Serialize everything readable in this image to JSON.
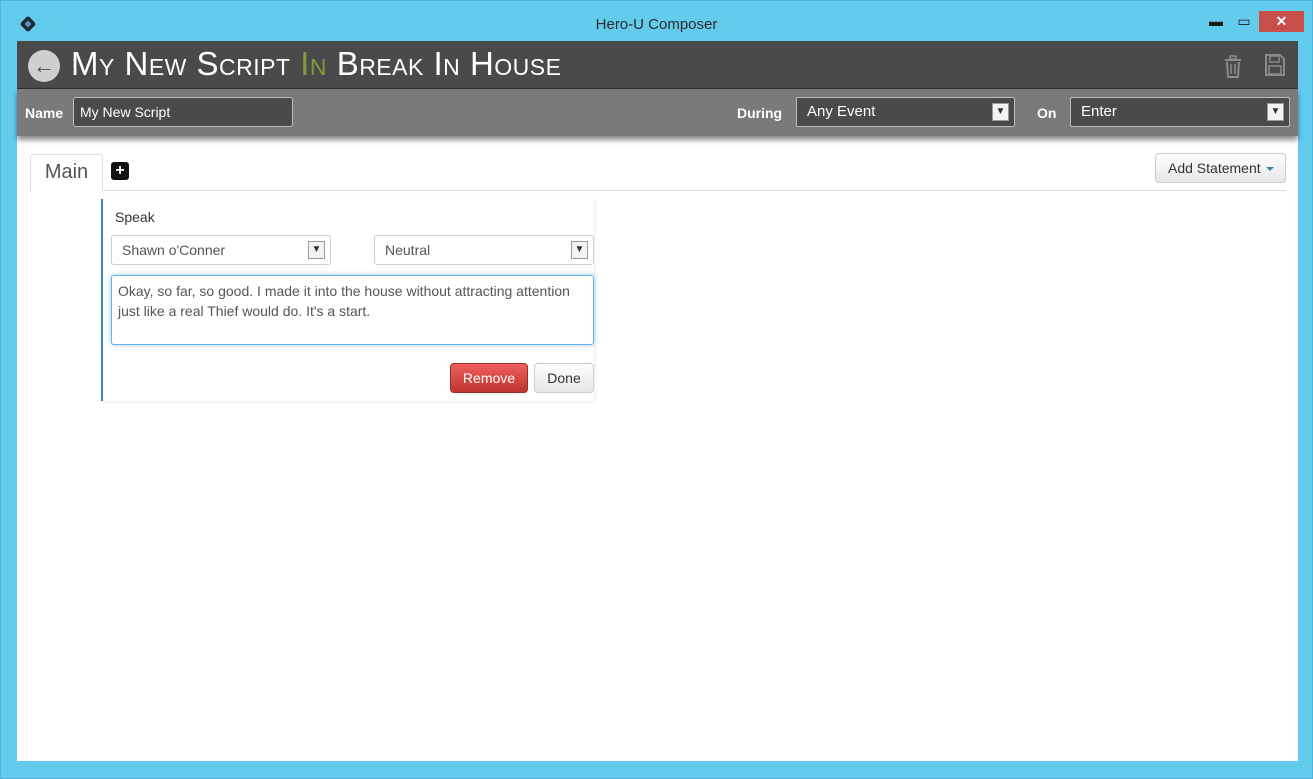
{
  "window": {
    "title": "Hero-U Composer",
    "minimize": "▬",
    "maximize": "▭",
    "close": "✕"
  },
  "header": {
    "title_parts": [
      "My New Script",
      "In",
      "Break In House"
    ],
    "back_icon": "arrow-left-icon",
    "trash_icon": "trash-icon",
    "save_icon": "save-icon",
    "accent_color": "#7f9b3c"
  },
  "subbar": {
    "name_label": "Name",
    "name_value": "My New Script",
    "during_label": "During",
    "during_value": "Any Event",
    "on_label": "On",
    "on_value": "Enter"
  },
  "tabs": {
    "main": "Main",
    "add": "+"
  },
  "toolbar": {
    "add_statement": "Add Statement"
  },
  "statement": {
    "type": "Speak",
    "speaker": "Shawn o'Conner",
    "mood": "Neutral",
    "text": "Okay, so far, so good. I made it into the house without attracting attention just like a real Thief would do. It's a start.",
    "remove_label": "Remove",
    "done_label": "Done"
  }
}
